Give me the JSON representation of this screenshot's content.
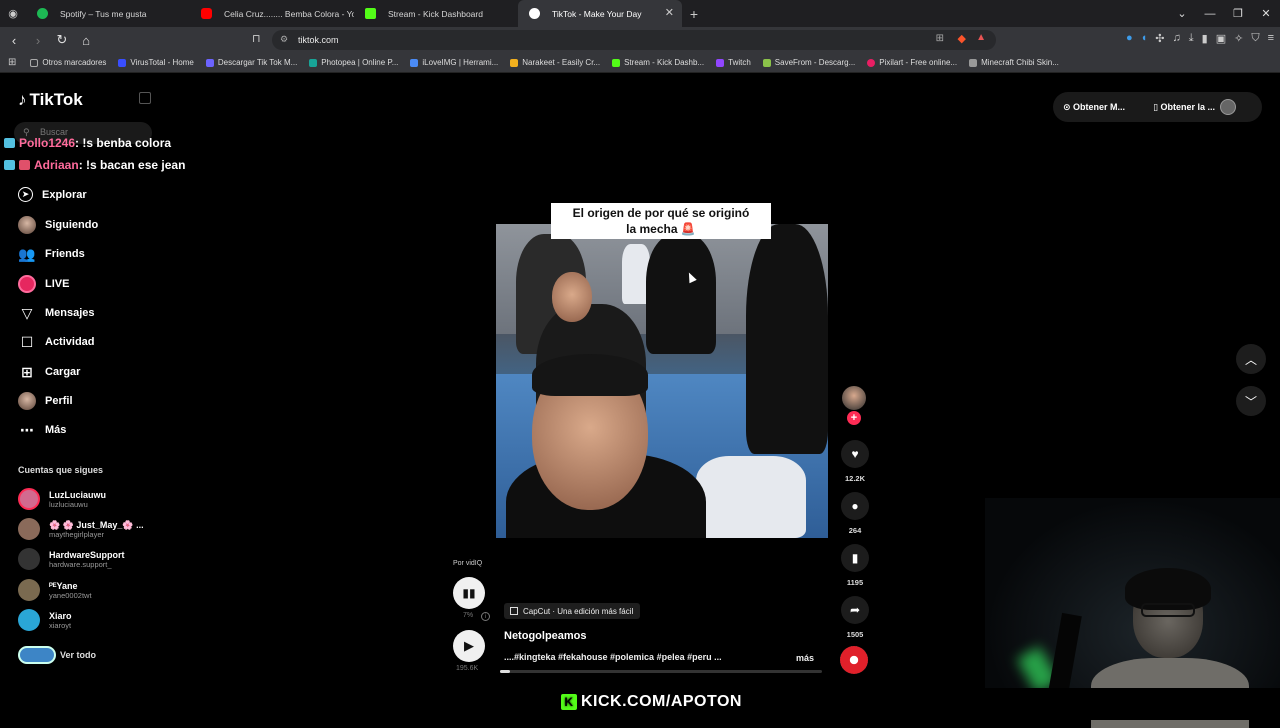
{
  "browser": {
    "tabs": [
      {
        "title": "Spotify – Tus me gusta",
        "favicon_color": "#1db954"
      },
      {
        "title": "Celia Cruz........ Bemba Colora - YouTu",
        "favicon_color": "#ff0000"
      },
      {
        "title": "Stream - Kick Dashboard",
        "favicon_color": "#53fc18"
      },
      {
        "title": "TikTok - Make Your Day",
        "favicon_color": "#ffffff"
      }
    ],
    "new_tab": "+",
    "window_controls": [
      "⌄",
      "—",
      "❐",
      "✕"
    ],
    "url": "tiktok.com",
    "bookmarks": [
      {
        "label": "Otros marcadores",
        "color": "#aaaaaa"
      },
      {
        "label": "VirusTotal - Home",
        "color": "#394eff"
      },
      {
        "label": "Descargar Tik Tok M...",
        "color": "#6c63ff"
      },
      {
        "label": "Photopea | Online P...",
        "color": "#18a497"
      },
      {
        "label": "iLoveIMG | Herrami...",
        "color": "#4b8bf5"
      },
      {
        "label": "Narakeet - Easily Cr...",
        "color": "#f2b01e"
      },
      {
        "label": "Stream - Kick Dashb...",
        "color": "#53fc18"
      },
      {
        "label": "Twitch",
        "color": "#9146ff"
      },
      {
        "label": "SaveFrom - Descarg...",
        "color": "#8bc34a"
      },
      {
        "label": "Pixilart - Free online...",
        "color": "#e91e63"
      },
      {
        "label": "Minecraft Chibi Skin...",
        "color": "#999999"
      }
    ]
  },
  "tiktok": {
    "logo": "TikTok",
    "search_placeholder": "Buscar",
    "chat_overlay": [
      {
        "user": "Pollo1246",
        "message": ": !s benba colora"
      },
      {
        "user": "Adriaan",
        "message": ": !s bacan ese jean"
      }
    ],
    "menu": [
      {
        "label": "Explorar",
        "icon": "compass-icon"
      },
      {
        "label": "Siguiendo",
        "icon": "avatar-icon"
      },
      {
        "label": "Friends",
        "icon": "friends-icon"
      },
      {
        "label": "LIVE",
        "icon": "live-icon"
      },
      {
        "label": "Mensajes",
        "icon": "send-icon"
      },
      {
        "label": "Actividad",
        "icon": "activity-icon"
      },
      {
        "label": "Cargar",
        "icon": "upload-icon"
      },
      {
        "label": "Perfil",
        "icon": "profile-icon"
      },
      {
        "label": "Más",
        "icon": "more-icon"
      }
    ],
    "following_title": "Cuentas que sigues",
    "following": [
      {
        "name": "LuzLuciauwu",
        "handle": "luzluciauwu",
        "color": "#d26a8f"
      },
      {
        "name": "🌸 🌸 Just_May_🌸 ...",
        "handle": "maythegirlplayer",
        "color": "#8a6a5a"
      },
      {
        "name": "HardwareSupport",
        "handle": "hardware.support_",
        "color": "#333333"
      },
      {
        "name": "ᴾᴱYane",
        "handle": "yane0002twt",
        "color": "#7a6a50"
      },
      {
        "name": "Xiaro",
        "handle": "xiaroyt",
        "color": "#2aa6d6"
      }
    ],
    "see_all": "Ver todo",
    "top_actions": {
      "get_app": "Obtener M...",
      "get_pc": "Obtener la ..."
    },
    "video": {
      "caption_line1": "El origen de por qué se originó",
      "caption_line2": "la mecha 🚨",
      "author": "Netogolpeamos",
      "description": "....#kingteka #fekahouse #polemica #pelea #peru ...",
      "more": "más",
      "capcut_label": "CapCut · Una edición más fácil",
      "progress": 0.03
    },
    "actions": {
      "likes": "12.2K",
      "comments": "264",
      "saves": "1195",
      "shares": "1505"
    },
    "vidiq": {
      "label": "Por vidIQ",
      "percent": "7%",
      "views": "195.6K"
    }
  },
  "stream_overlay": {
    "kick_url": "KICK.COM/APOTON",
    "kick_icon": "K"
  }
}
